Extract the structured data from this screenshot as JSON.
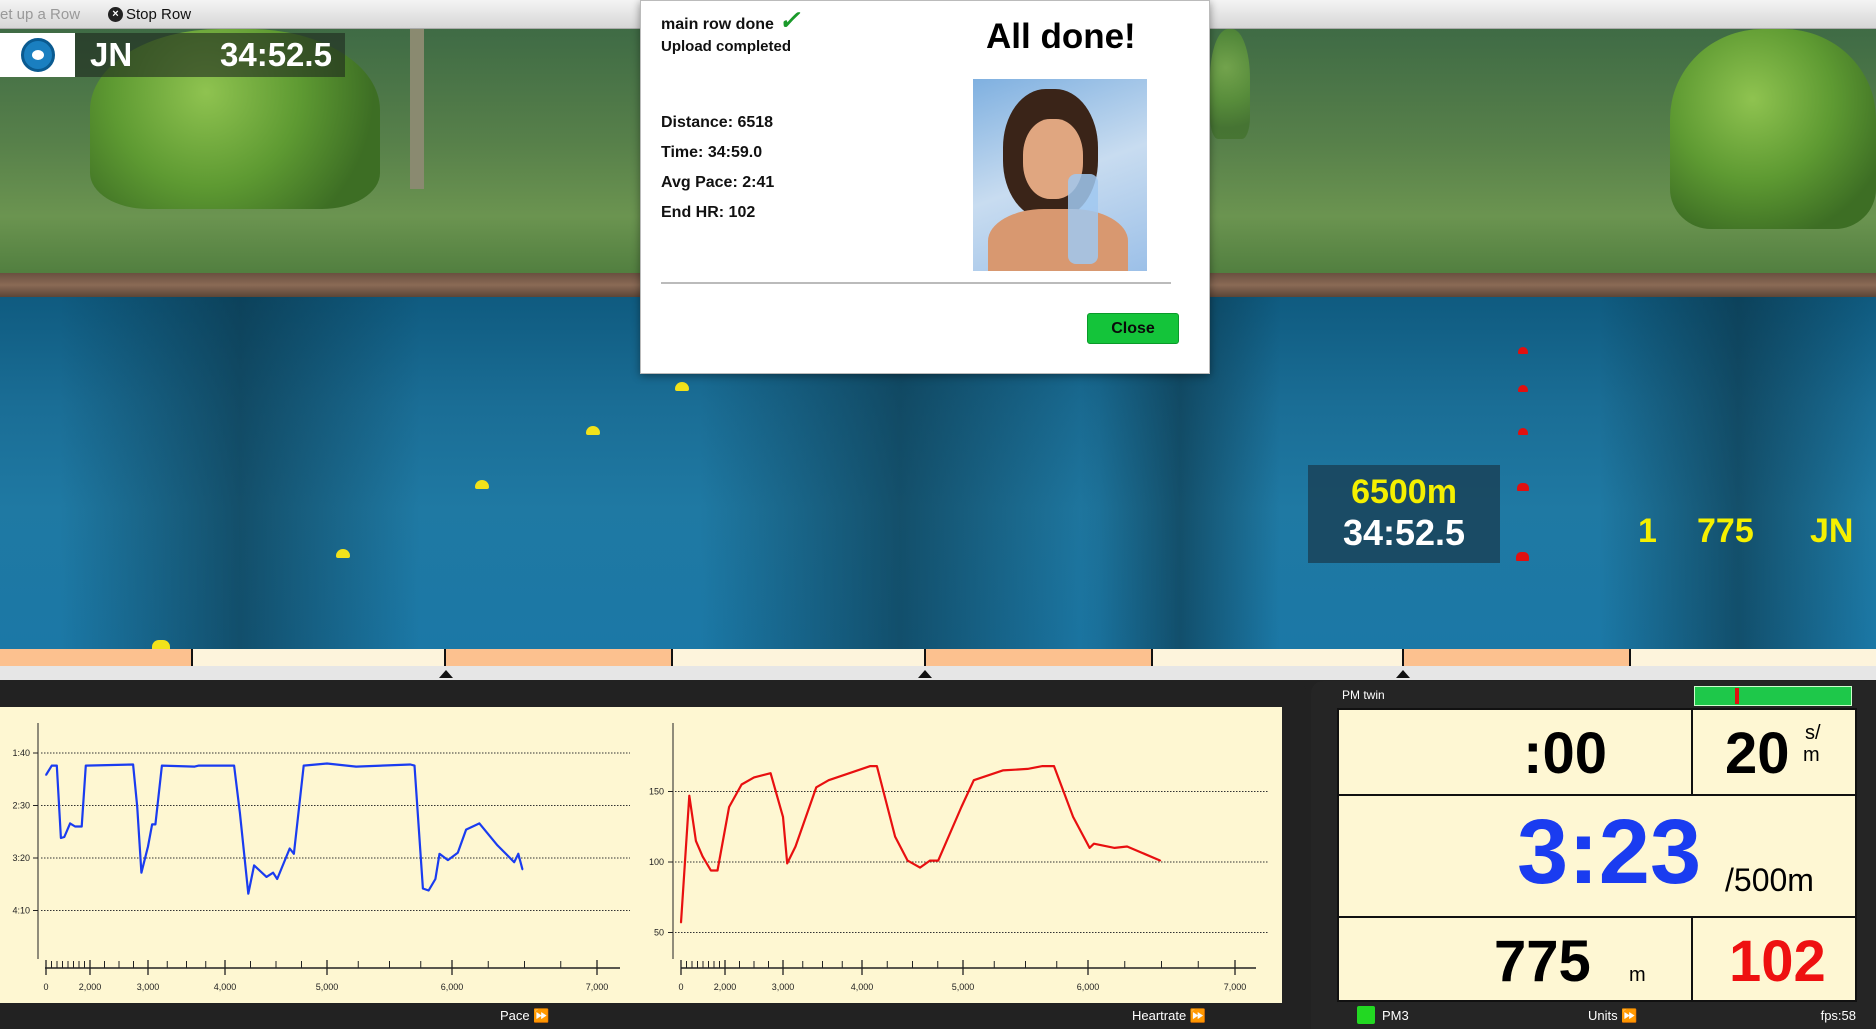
{
  "toolbar": {
    "setup_label": "et up a Row",
    "stop_label": "Stop Row",
    "stop_icon": "x-circle-icon"
  },
  "hud": {
    "name": "JN",
    "time": "34:52.5"
  },
  "scene": {
    "distance": "6500m",
    "time": "34:52.5",
    "place": "1",
    "meters": "775",
    "name": "JN"
  },
  "modal": {
    "status": "main row done",
    "check": "✓",
    "upload": "Upload completed",
    "title": "All done!",
    "stats": [
      "Distance: 6518",
      "Time: 34:59.0",
      "Avg Pace: 2:41",
      "End HR: 102"
    ],
    "close_label": "Close"
  },
  "charts": {
    "pace_label": "Pace",
    "hr_label": "Heartrate",
    "arrow": "⏩"
  },
  "pm": {
    "title": "PM twin",
    "time": ":00",
    "spm": "20",
    "spm_unit_top": "s/",
    "spm_unit_bottom": "m",
    "pace": "3:23",
    "pace_unit": "/500m",
    "meters": "775",
    "meters_unit": "m",
    "hr": "102",
    "monitor": "PM3",
    "units_label": "Units ⏩",
    "fps": "fps:58",
    "drag_indicator": 0.26
  },
  "colors": {
    "pace_line": "#1a3cf0",
    "hr_line": "#e81010",
    "pm_pace": "#1a3cf0",
    "pm_hr": "#ee1010",
    "scene_labels": "#f5f000",
    "close_button": "#14c43a",
    "status_ok": "#22d822"
  },
  "chart_data": [
    {
      "type": "line",
      "name": "Pace",
      "xlim": [
        0,
        7000
      ],
      "ylim": [
        "1:10",
        "4:55"
      ],
      "y_inverted": true,
      "grid": true,
      "x_ticks": [
        "0",
        "2,000",
        "3,000",
        "4,000",
        "5,000",
        "6,000",
        "7,000"
      ],
      "y_ticks": [
        "1:40",
        "2:30",
        "3:20",
        "4:10"
      ],
      "x": [
        0,
        264,
        490,
        679,
        830,
        1094,
        1321,
        1623,
        1811,
        2743,
        2814,
        2886,
        3000,
        3053,
        3096,
        3181,
        3606,
        3660,
        4089,
        4146,
        4228,
        4285,
        4407,
        4472,
        4512,
        4634,
        4675,
        4772,
        5000,
        5233,
        5667,
        5700,
        5767,
        5813,
        5867,
        5900,
        5967,
        6040,
        6097,
        6189,
        6314,
        6429,
        6457,
        6486
      ],
      "y": [
        "2:01",
        "1:52",
        "1:52",
        "3:01",
        "3:00",
        "2:47",
        "2:50",
        "2:50",
        "1:52",
        "1:51",
        "2:31",
        "3:34",
        "3:09",
        "2:48",
        "2:48",
        "1:52",
        "1:53",
        "1:52",
        "1:52",
        "2:37",
        "3:54",
        "3:27",
        "3:38",
        "3:34",
        "3:40",
        "3:11",
        "3:16",
        "1:52",
        "1:50",
        "1:53",
        "1:51",
        "1:52",
        "3:49",
        "3:51",
        "3:40",
        "3:16",
        "3:22",
        "3:15",
        "2:53",
        "2:47",
        "3:08",
        "3:24",
        "3:16",
        "3:31"
      ]
    },
    {
      "type": "line",
      "name": "Heartrate",
      "xlim": [
        0,
        7000
      ],
      "ylim": [
        30,
        198
      ],
      "grid": true,
      "x_ticks": [
        "0",
        "2,000",
        "3,000",
        "4,000",
        "5,000",
        "6,000",
        "7,000"
      ],
      "y_ticks": [
        "50",
        "100",
        "150"
      ],
      "x": [
        0,
        377,
        679,
        981,
        1358,
        1660,
        2071,
        2286,
        2500,
        2786,
        3000,
        3053,
        3158,
        3421,
        3579,
        3789,
        4082,
        4148,
        4328,
        4451,
        4574,
        4672,
        4754,
        4984,
        5086,
        5318,
        5517,
        5636,
        5728,
        5881,
        6011,
        6040,
        6181,
        6266,
        6492
      ],
      "y": [
        57,
        147,
        115,
        104,
        94,
        94,
        139,
        155,
        160,
        163,
        132,
        99,
        111,
        153,
        158,
        162,
        168,
        168,
        118,
        101,
        96,
        101,
        101,
        139,
        158,
        165,
        166,
        168,
        168,
        132,
        110,
        113,
        110,
        111,
        101
      ]
    }
  ]
}
